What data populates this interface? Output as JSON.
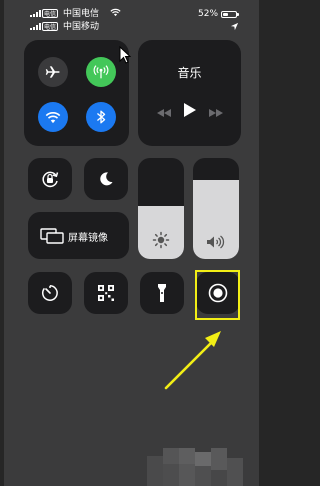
{
  "status_bar": {
    "sim1_tag": "电信",
    "sim1_carrier": "中国电信",
    "sim2_tag": "电信",
    "sim2_carrier": "中国移动",
    "battery_percent": "52%",
    "battery_level": 0.52
  },
  "connectivity": {
    "airplane_mode": {
      "on": false,
      "icon": "airplane-icon"
    },
    "cellular_data": {
      "on": true,
      "icon": "antenna-icon",
      "color": "#43c759"
    },
    "wifi": {
      "on": true,
      "icon": "wifi-icon",
      "color": "#1b79f1"
    },
    "bluetooth": {
      "on": true,
      "icon": "bluetooth-icon",
      "color": "#1b79f1"
    }
  },
  "music": {
    "title": "音乐",
    "controls": [
      "rewind",
      "play",
      "fast-forward"
    ]
  },
  "toggles": {
    "orientation_lock": {
      "icon": "rotation-lock-icon"
    },
    "do_not_disturb": {
      "icon": "moon-icon"
    }
  },
  "screen_mirroring": {
    "label": "屏幕镜像",
    "icon": "screen-mirroring-icon"
  },
  "sliders": {
    "brightness": {
      "level": 0.52,
      "icon": "sun-icon"
    },
    "volume": {
      "level": 0.78,
      "icon": "speaker-icon"
    }
  },
  "bottom_row": [
    {
      "name": "timer",
      "icon": "timer-icon"
    },
    {
      "name": "qr-scanner",
      "icon": "qr-code-icon"
    },
    {
      "name": "flashlight",
      "icon": "flashlight-icon"
    },
    {
      "name": "screen-recording",
      "icon": "record-icon",
      "highlighted": true
    }
  ],
  "colors": {
    "panel_bg": "#3b3b3c",
    "module_bg": "#1c1c1e",
    "highlight": "#f2ee16",
    "arrow": "#f2ee16"
  }
}
